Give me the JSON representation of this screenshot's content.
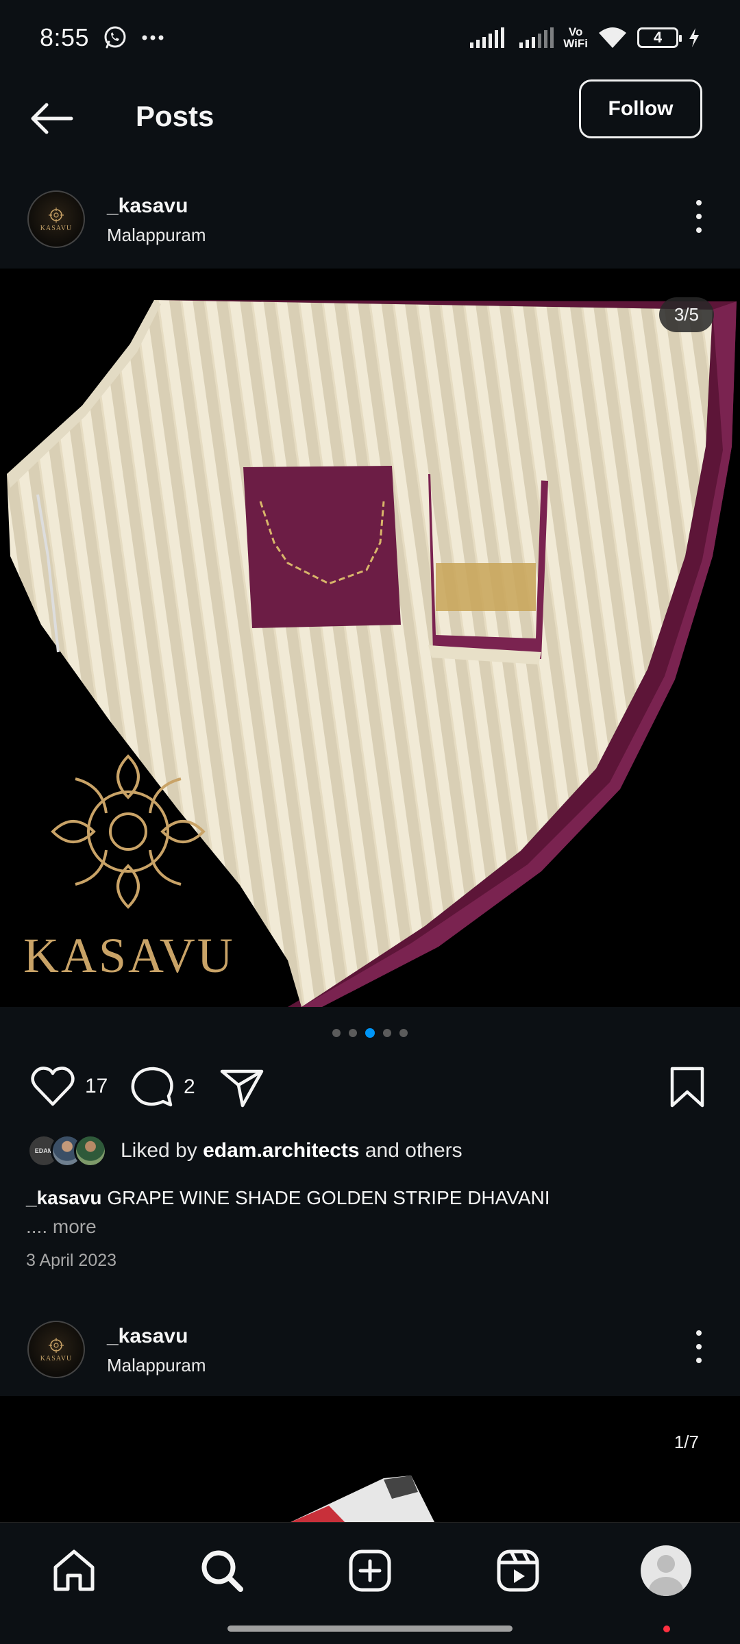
{
  "status_bar": {
    "time": "8:55",
    "wifi_label_top": "Vo",
    "wifi_label_bottom": "WiFi",
    "battery": "4"
  },
  "header": {
    "title": "Posts",
    "follow_label": "Follow"
  },
  "post1": {
    "username": "_kasavu",
    "location": "Malappuram",
    "counter": "3/5",
    "brand_text": "KASAVU",
    "carousel": {
      "total": 5,
      "active_index": 2
    },
    "likes": "17",
    "comments": "2",
    "liked_by_prefix": "Liked by ",
    "liked_by_user": "edam.architects",
    "liked_by_suffix": " and others",
    "caption_user": "_kasavu",
    "caption_text": " GRAPE WINE SHADE GOLDEN STRIPE DHAVANI",
    "caption_more": ".... more",
    "date": "3 April 2023"
  },
  "post2": {
    "username": "_kasavu",
    "location": "Malappuram",
    "counter": "1/7"
  },
  "avatar_logo_text": "KASAVU",
  "mini_avatar_text": "EDAM",
  "colors": {
    "background": "#0c1014",
    "accent": "#0095f6",
    "fabric_cream": "#efe7cf",
    "fabric_wine": "#6c1d45",
    "gold": "#c9a367"
  },
  "bottom_nav": [
    "home-icon",
    "search-icon",
    "create-icon",
    "reels-icon",
    "profile-avatar"
  ]
}
